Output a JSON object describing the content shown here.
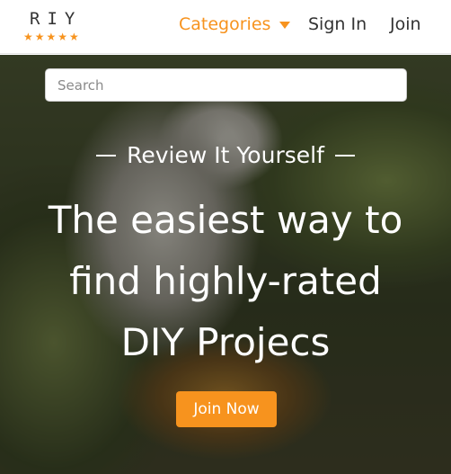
{
  "brand": {
    "logo_text": "RIY",
    "stars": "★★★★★",
    "accent_color": "#f7931e"
  },
  "nav": {
    "categories_label": "Categories",
    "signin_label": "Sign In",
    "join_label": "Join"
  },
  "search": {
    "placeholder": "Search",
    "value": ""
  },
  "hero": {
    "tagline": "Review It Yourself",
    "headline_lines": [
      "The easiest way to",
      "find highly-rated",
      "DIY Projecs"
    ],
    "cta_label": "Join Now"
  }
}
